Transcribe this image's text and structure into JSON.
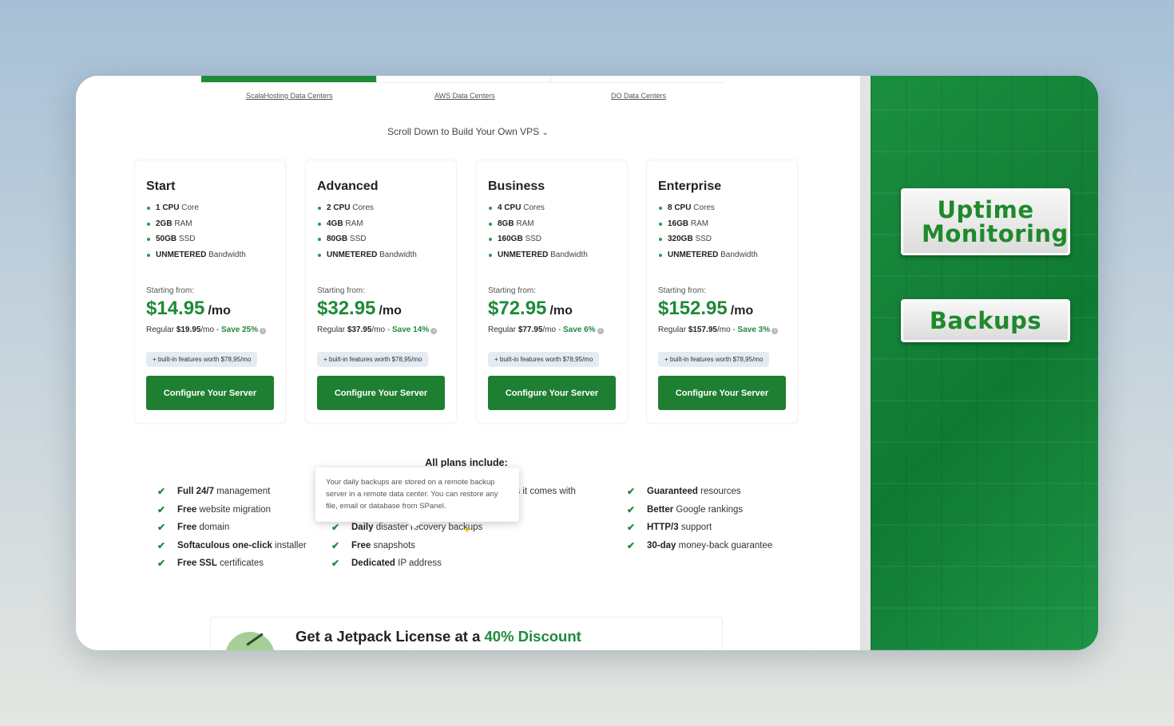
{
  "tabs": [
    {
      "label": "ScalaHosting Data Centers",
      "active": true
    },
    {
      "label": "AWS Data Centers",
      "active": false
    },
    {
      "label": "DO Data Centers",
      "active": false
    }
  ],
  "scroll_hint": "Scroll Down to Build Your Own VPS",
  "plans": [
    {
      "name": "Start",
      "specs": [
        {
          "strong": "1 CPU",
          "rest": " Core"
        },
        {
          "strong": "2GB",
          "rest": " RAM"
        },
        {
          "strong": "50GB",
          "rest": " SSD"
        },
        {
          "strong": "UNMETERED",
          "rest": " Bandwidth"
        }
      ],
      "starting_label": "Starting from:",
      "price": "$14.95",
      "per": "/mo",
      "regular_prefix": "Regular ",
      "regular_amount": "$19.95",
      "regular_suffix": "/mo - ",
      "save": "Save 25%",
      "features_pill": "+ built-in features worth $78,95/mo",
      "cta": "Configure Your Server"
    },
    {
      "name": "Advanced",
      "specs": [
        {
          "strong": "2 CPU",
          "rest": " Cores"
        },
        {
          "strong": "4GB",
          "rest": " RAM"
        },
        {
          "strong": "80GB",
          "rest": " SSD"
        },
        {
          "strong": "UNMETERED",
          "rest": " Bandwidth"
        }
      ],
      "starting_label": "Starting from:",
      "price": "$32.95",
      "per": "/mo",
      "regular_prefix": "Regular ",
      "regular_amount": "$37.95",
      "regular_suffix": "/mo - ",
      "save": "Save 14%",
      "features_pill": "+ built-in features worth $78,95/mo",
      "cta": "Configure Your Server"
    },
    {
      "name": "Business",
      "specs": [
        {
          "strong": "4 CPU",
          "rest": " Cores"
        },
        {
          "strong": "8GB",
          "rest": " RAM"
        },
        {
          "strong": "160GB",
          "rest": " SSD"
        },
        {
          "strong": "UNMETERED",
          "rest": " Bandwidth"
        }
      ],
      "starting_label": "Starting from:",
      "price": "$72.95",
      "per": "/mo",
      "regular_prefix": "Regular ",
      "regular_amount": "$77.95",
      "regular_suffix": "/mo - ",
      "save": "Save 6%",
      "features_pill": "+ built-in features worth $78,95/mo",
      "cta": "Configure Your Server"
    },
    {
      "name": "Enterprise",
      "specs": [
        {
          "strong": "8 CPU",
          "rest": " Cores"
        },
        {
          "strong": "16GB",
          "rest": " RAM"
        },
        {
          "strong": "320GB",
          "rest": " SSD"
        },
        {
          "strong": "UNMETERED",
          "rest": " Bandwidth"
        }
      ],
      "starting_label": "Starting from:",
      "price": "$152.95",
      "per": "/mo",
      "regular_prefix": "Regular ",
      "regular_amount": "$157.95",
      "regular_suffix": "/mo - ",
      "save": "Save 3%",
      "features_pill": "+ built-in features worth $78,95/mo",
      "cta": "Configure Your Server"
    }
  ],
  "all_plans_title": "All plans include:",
  "features": {
    "col1": [
      {
        "strong": "Full 24/7",
        "rest": " management"
      },
      {
        "strong": "Free",
        "rest": " website migration"
      },
      {
        "strong": "Free",
        "rest": " domain"
      },
      {
        "strong": "Softaculous one-click",
        "rest": " installer"
      },
      {
        "strong": "Free SSL",
        "rest": " certificates"
      }
    ],
    "col2_partial": [
      {
        "strong": "",
        "rest": "vices it comes with"
      },
      {
        "strong": "",
        "rest": "on"
      }
    ],
    "col2": [
      {
        "strong": "Daily",
        "rest": " disaster recovery backups"
      },
      {
        "strong": "Free",
        "rest": " snapshots"
      },
      {
        "strong": "Dedicated",
        "rest": " IP address"
      }
    ],
    "col3": [
      {
        "strong": "Guaranteed",
        "rest": " resources"
      },
      {
        "strong": "Better",
        "rest": " Google rankings"
      },
      {
        "strong": "HTTP/3",
        "rest": " support"
      },
      {
        "strong": "30-day",
        "rest": " money-back guarantee"
      }
    ]
  },
  "tooltip": "Your daily backups are stored on a remote backup server in a remote data center. You can restore any file, email or database from SPanel.",
  "jetpack": {
    "title_prefix": "Get a Jetpack License at a ",
    "title_highlight": "40% Discount"
  },
  "side_buttons": {
    "uptime": "Uptime Monitoring",
    "backups": "Backups"
  },
  "colors": {
    "brand_green": "#1e8a3a",
    "button_green": "#1e7f32",
    "side_panel_green": "#178a3b"
  }
}
